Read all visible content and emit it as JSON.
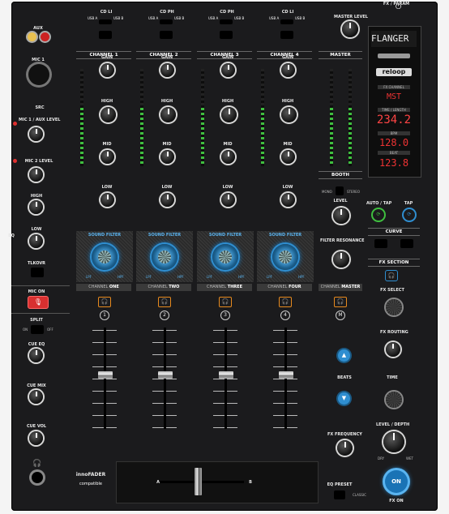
{
  "top": {
    "sources": [
      {
        "ch": "CD",
        "sel": "LI",
        "a": "USB A",
        "b": "USB B"
      },
      {
        "ch": "CD",
        "sel": "PH",
        "a": "USB A",
        "b": "USB B"
      },
      {
        "ch": "CD",
        "sel": "PH",
        "a": "USB A",
        "b": "USB B"
      },
      {
        "ch": "CD",
        "sel": "LI",
        "a": "USB A",
        "b": "USB B"
      }
    ],
    "master_level": "MASTER LEVEL",
    "fx_param": "FX / PARAM"
  },
  "left": {
    "aux": "AUX",
    "mic1": "MIC 1",
    "src": "SRC",
    "mic1_aux_level": "MIC 1 / AUX LEVEL",
    "mic2_level": "MIC 2 LEVEL",
    "high": "HIGH",
    "low": "LOW",
    "eq": "EQ",
    "talkover": "TLKOVR",
    "mic_on": "MIC ON",
    "split": "SPLIT",
    "on": "ON",
    "off": "OFF",
    "cue_eq": "CUE EQ",
    "cue_mix": "CUE MIX",
    "cue_vol": "CUE VOL",
    "innofader": "innoFADER",
    "compatible": "compatible"
  },
  "channels": [
    {
      "title": "CHANNEL 1",
      "gain": "GAIN",
      "high": "HIGH",
      "mid": "MID",
      "low": "LOW",
      "sf": "SOUND FILTER",
      "lpf": "LPF",
      "hpf": "HPF",
      "name_a": "CHANNEL",
      "name_b": "ONE",
      "num": "1"
    },
    {
      "title": "CHANNEL 2",
      "gain": "GAIN",
      "high": "HIGH",
      "mid": "MID",
      "low": "LOW",
      "sf": "SOUND FILTER",
      "lpf": "LPF",
      "hpf": "HPF",
      "name_a": "CHANNEL",
      "name_b": "TWO",
      "num": "2"
    },
    {
      "title": "CHANNEL 3",
      "gain": "GAIN",
      "high": "HIGH",
      "mid": "MID",
      "low": "LOW",
      "sf": "SOUND FILTER",
      "lpf": "LPF",
      "hpf": "HPF",
      "name_a": "CHANNEL",
      "name_b": "THREE",
      "num": "3"
    },
    {
      "title": "CHANNEL 4",
      "gain": "GAIN",
      "high": "HIGH",
      "mid": "MID",
      "low": "LOW",
      "sf": "SOUND FILTER",
      "lpf": "LPF",
      "hpf": "HPF",
      "name_a": "CHANNEL",
      "name_b": "FOUR",
      "num": "4"
    }
  ],
  "master": {
    "title": "MASTER",
    "booth": "BOOTH",
    "mono": "MONO",
    "stereo": "STEREO",
    "level": "LEVEL",
    "filter_resonance": "FILTER RESONANCE",
    "name_a": "CHANNEL",
    "name_b": "MASTER",
    "cue_label": "M",
    "beats": "BEATS",
    "fx_frequency": "FX FREQUENCY",
    "eq_preset": "EQ PRESET",
    "classic": "CLASSIC"
  },
  "fx": {
    "display": "FLANGER",
    "brand": "reloop",
    "fx_channel": "FX CHANNEL",
    "ch_value": "MST",
    "time_length": "TIME / LENGTH",
    "time_value": "234.2",
    "bpm_label": "BPM",
    "bpm_value": "128.0",
    "beat_label": "BEAT",
    "beat_value": "123.8",
    "auto_tap": "AUTO / TAP",
    "tap": "TAP",
    "curve": "CURVE",
    "fx_section": "FX SECTION",
    "fx_select": "FX SELECT",
    "fx_routing": "FX ROUTING",
    "time": "TIME",
    "level_depth": "LEVEL / DEPTH",
    "fx_on": "FX ON",
    "on": "ON",
    "dry": "DRY",
    "wet": "WET"
  },
  "crossfader": {
    "a": "A",
    "b": "B"
  },
  "colors": {
    "accent_blue": "#2f8ed0",
    "cue_orange": "#e78a1e",
    "mic_red": "#e03030",
    "meter_green": "#3fbf3f"
  }
}
